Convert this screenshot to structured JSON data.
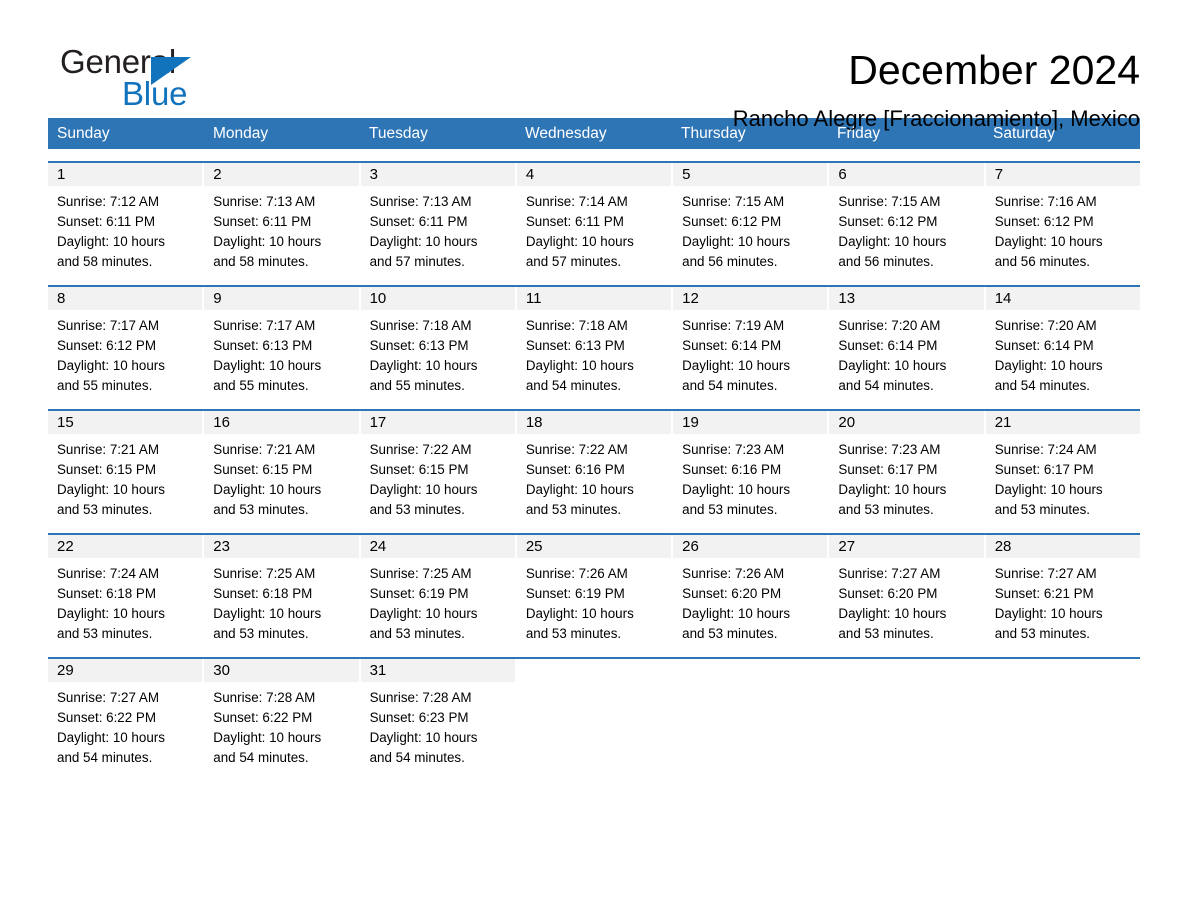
{
  "brand": {
    "name_part1": "General",
    "name_part2": "Blue",
    "triangle_color": "#1273bd"
  },
  "header": {
    "title": "December 2024",
    "subtitle": "Rancho Alegre [Fraccionamiento], Mexico"
  },
  "theme": {
    "header_bar_color": "#2e75b6",
    "daynum_strip_color": "#f2f2f2",
    "text_color": "#000000"
  },
  "weekdays": [
    "Sunday",
    "Monday",
    "Tuesday",
    "Wednesday",
    "Thursday",
    "Friday",
    "Saturday"
  ],
  "weeks": [
    [
      {
        "day": "1",
        "sunrise": "Sunrise: 7:12 AM",
        "sunset": "Sunset: 6:11 PM",
        "daylight1": "Daylight: 10 hours",
        "daylight2": "and 58 minutes."
      },
      {
        "day": "2",
        "sunrise": "Sunrise: 7:13 AM",
        "sunset": "Sunset: 6:11 PM",
        "daylight1": "Daylight: 10 hours",
        "daylight2": "and 58 minutes."
      },
      {
        "day": "3",
        "sunrise": "Sunrise: 7:13 AM",
        "sunset": "Sunset: 6:11 PM",
        "daylight1": "Daylight: 10 hours",
        "daylight2": "and 57 minutes."
      },
      {
        "day": "4",
        "sunrise": "Sunrise: 7:14 AM",
        "sunset": "Sunset: 6:11 PM",
        "daylight1": "Daylight: 10 hours",
        "daylight2": "and 57 minutes."
      },
      {
        "day": "5",
        "sunrise": "Sunrise: 7:15 AM",
        "sunset": "Sunset: 6:12 PM",
        "daylight1": "Daylight: 10 hours",
        "daylight2": "and 56 minutes."
      },
      {
        "day": "6",
        "sunrise": "Sunrise: 7:15 AM",
        "sunset": "Sunset: 6:12 PM",
        "daylight1": "Daylight: 10 hours",
        "daylight2": "and 56 minutes."
      },
      {
        "day": "7",
        "sunrise": "Sunrise: 7:16 AM",
        "sunset": "Sunset: 6:12 PM",
        "daylight1": "Daylight: 10 hours",
        "daylight2": "and 56 minutes."
      }
    ],
    [
      {
        "day": "8",
        "sunrise": "Sunrise: 7:17 AM",
        "sunset": "Sunset: 6:12 PM",
        "daylight1": "Daylight: 10 hours",
        "daylight2": "and 55 minutes."
      },
      {
        "day": "9",
        "sunrise": "Sunrise: 7:17 AM",
        "sunset": "Sunset: 6:13 PM",
        "daylight1": "Daylight: 10 hours",
        "daylight2": "and 55 minutes."
      },
      {
        "day": "10",
        "sunrise": "Sunrise: 7:18 AM",
        "sunset": "Sunset: 6:13 PM",
        "daylight1": "Daylight: 10 hours",
        "daylight2": "and 55 minutes."
      },
      {
        "day": "11",
        "sunrise": "Sunrise: 7:18 AM",
        "sunset": "Sunset: 6:13 PM",
        "daylight1": "Daylight: 10 hours",
        "daylight2": "and 54 minutes."
      },
      {
        "day": "12",
        "sunrise": "Sunrise: 7:19 AM",
        "sunset": "Sunset: 6:14 PM",
        "daylight1": "Daylight: 10 hours",
        "daylight2": "and 54 minutes."
      },
      {
        "day": "13",
        "sunrise": "Sunrise: 7:20 AM",
        "sunset": "Sunset: 6:14 PM",
        "daylight1": "Daylight: 10 hours",
        "daylight2": "and 54 minutes."
      },
      {
        "day": "14",
        "sunrise": "Sunrise: 7:20 AM",
        "sunset": "Sunset: 6:14 PM",
        "daylight1": "Daylight: 10 hours",
        "daylight2": "and 54 minutes."
      }
    ],
    [
      {
        "day": "15",
        "sunrise": "Sunrise: 7:21 AM",
        "sunset": "Sunset: 6:15 PM",
        "daylight1": "Daylight: 10 hours",
        "daylight2": "and 53 minutes."
      },
      {
        "day": "16",
        "sunrise": "Sunrise: 7:21 AM",
        "sunset": "Sunset: 6:15 PM",
        "daylight1": "Daylight: 10 hours",
        "daylight2": "and 53 minutes."
      },
      {
        "day": "17",
        "sunrise": "Sunrise: 7:22 AM",
        "sunset": "Sunset: 6:15 PM",
        "daylight1": "Daylight: 10 hours",
        "daylight2": "and 53 minutes."
      },
      {
        "day": "18",
        "sunrise": "Sunrise: 7:22 AM",
        "sunset": "Sunset: 6:16 PM",
        "daylight1": "Daylight: 10 hours",
        "daylight2": "and 53 minutes."
      },
      {
        "day": "19",
        "sunrise": "Sunrise: 7:23 AM",
        "sunset": "Sunset: 6:16 PM",
        "daylight1": "Daylight: 10 hours",
        "daylight2": "and 53 minutes."
      },
      {
        "day": "20",
        "sunrise": "Sunrise: 7:23 AM",
        "sunset": "Sunset: 6:17 PM",
        "daylight1": "Daylight: 10 hours",
        "daylight2": "and 53 minutes."
      },
      {
        "day": "21",
        "sunrise": "Sunrise: 7:24 AM",
        "sunset": "Sunset: 6:17 PM",
        "daylight1": "Daylight: 10 hours",
        "daylight2": "and 53 minutes."
      }
    ],
    [
      {
        "day": "22",
        "sunrise": "Sunrise: 7:24 AM",
        "sunset": "Sunset: 6:18 PM",
        "daylight1": "Daylight: 10 hours",
        "daylight2": "and 53 minutes."
      },
      {
        "day": "23",
        "sunrise": "Sunrise: 7:25 AM",
        "sunset": "Sunset: 6:18 PM",
        "daylight1": "Daylight: 10 hours",
        "daylight2": "and 53 minutes."
      },
      {
        "day": "24",
        "sunrise": "Sunrise: 7:25 AM",
        "sunset": "Sunset: 6:19 PM",
        "daylight1": "Daylight: 10 hours",
        "daylight2": "and 53 minutes."
      },
      {
        "day": "25",
        "sunrise": "Sunrise: 7:26 AM",
        "sunset": "Sunset: 6:19 PM",
        "daylight1": "Daylight: 10 hours",
        "daylight2": "and 53 minutes."
      },
      {
        "day": "26",
        "sunrise": "Sunrise: 7:26 AM",
        "sunset": "Sunset: 6:20 PM",
        "daylight1": "Daylight: 10 hours",
        "daylight2": "and 53 minutes."
      },
      {
        "day": "27",
        "sunrise": "Sunrise: 7:27 AM",
        "sunset": "Sunset: 6:20 PM",
        "daylight1": "Daylight: 10 hours",
        "daylight2": "and 53 minutes."
      },
      {
        "day": "28",
        "sunrise": "Sunrise: 7:27 AM",
        "sunset": "Sunset: 6:21 PM",
        "daylight1": "Daylight: 10 hours",
        "daylight2": "and 53 minutes."
      }
    ],
    [
      {
        "day": "29",
        "sunrise": "Sunrise: 7:27 AM",
        "sunset": "Sunset: 6:22 PM",
        "daylight1": "Daylight: 10 hours",
        "daylight2": "and 54 minutes."
      },
      {
        "day": "30",
        "sunrise": "Sunrise: 7:28 AM",
        "sunset": "Sunset: 6:22 PM",
        "daylight1": "Daylight: 10 hours",
        "daylight2": "and 54 minutes."
      },
      {
        "day": "31",
        "sunrise": "Sunrise: 7:28 AM",
        "sunset": "Sunset: 6:23 PM",
        "daylight1": "Daylight: 10 hours",
        "daylight2": "and 54 minutes."
      },
      {
        "day": "",
        "sunrise": "",
        "sunset": "",
        "daylight1": "",
        "daylight2": ""
      },
      {
        "day": "",
        "sunrise": "",
        "sunset": "",
        "daylight1": "",
        "daylight2": ""
      },
      {
        "day": "",
        "sunrise": "",
        "sunset": "",
        "daylight1": "",
        "daylight2": ""
      },
      {
        "day": "",
        "sunrise": "",
        "sunset": "",
        "daylight1": "",
        "daylight2": ""
      }
    ]
  ]
}
